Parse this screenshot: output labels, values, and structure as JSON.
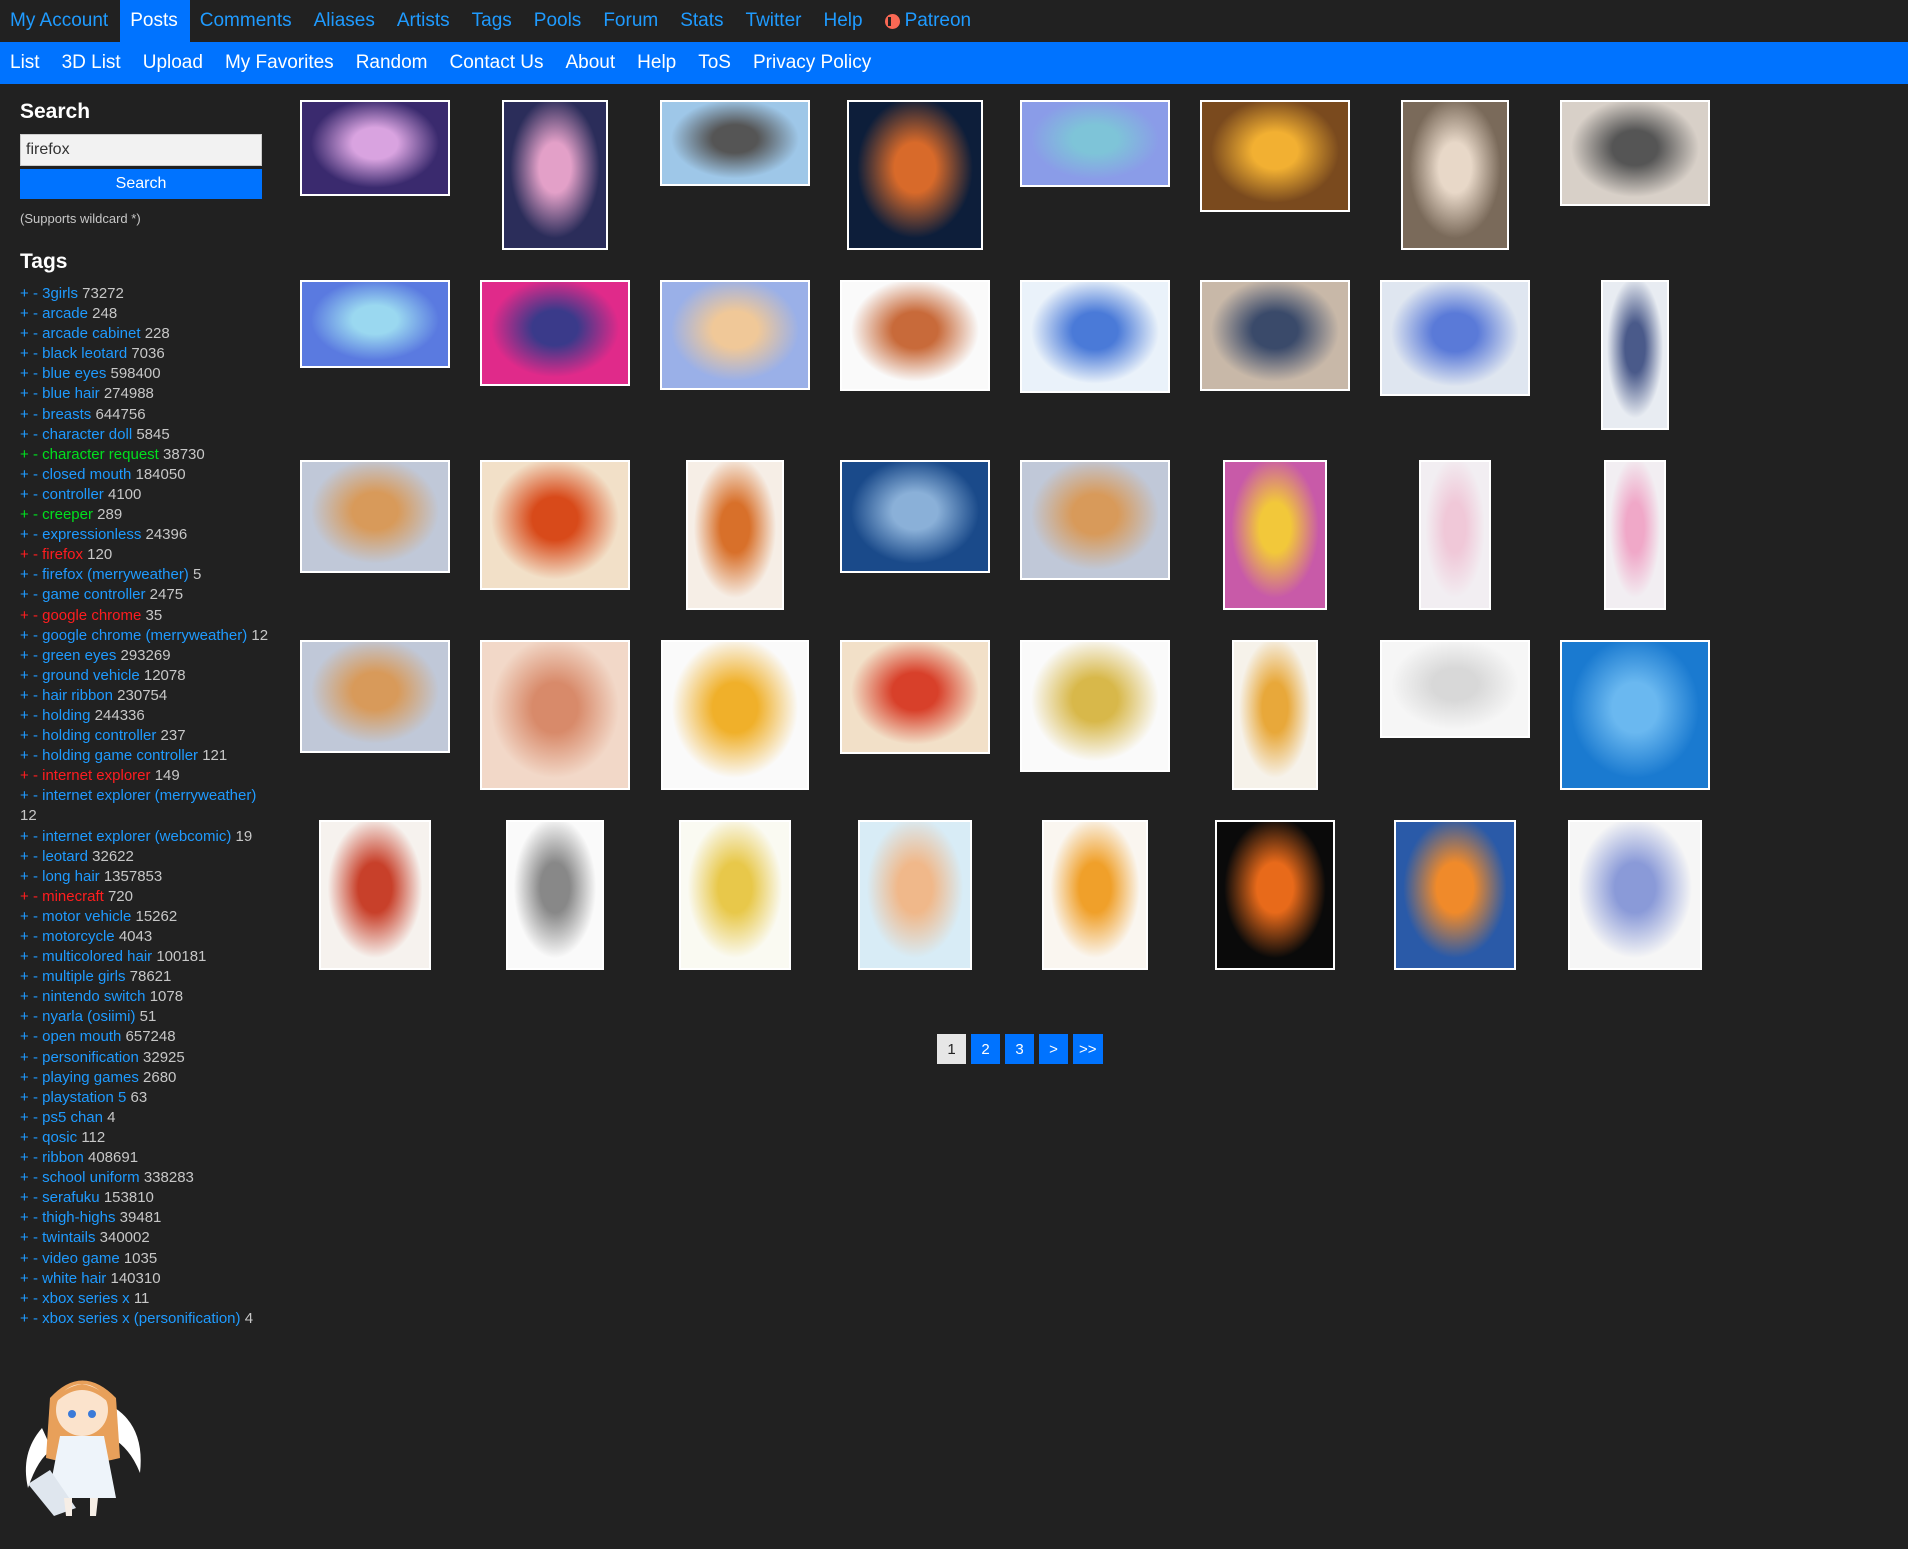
{
  "topnav": [
    {
      "label": "My Account",
      "active": false
    },
    {
      "label": "Posts",
      "active": true
    },
    {
      "label": "Comments",
      "active": false
    },
    {
      "label": "Aliases",
      "active": false
    },
    {
      "label": "Artists",
      "active": false
    },
    {
      "label": "Tags",
      "active": false
    },
    {
      "label": "Pools",
      "active": false
    },
    {
      "label": "Forum",
      "active": false
    },
    {
      "label": "Stats",
      "active": false
    },
    {
      "label": "Twitter",
      "active": false
    },
    {
      "label": "Help",
      "active": false
    },
    {
      "label": "Patreon",
      "active": false,
      "icon": "patreon-icon"
    }
  ],
  "subnav": [
    "List",
    "3D List",
    "Upload",
    "My Favorites",
    "Random",
    "Contact Us",
    "About",
    "Help",
    "ToS",
    "Privacy Policy"
  ],
  "search": {
    "heading": "Search",
    "value": "firefox",
    "button": "Search",
    "note": "(Supports wildcard *)"
  },
  "tags_heading": "Tags",
  "tags": [
    {
      "name": "3girls",
      "count": "73272",
      "type": "normal"
    },
    {
      "name": "arcade",
      "count": "248",
      "type": "normal"
    },
    {
      "name": "arcade cabinet",
      "count": "228",
      "type": "normal"
    },
    {
      "name": "black leotard",
      "count": "7036",
      "type": "normal"
    },
    {
      "name": "blue eyes",
      "count": "598400",
      "type": "normal"
    },
    {
      "name": "blue hair",
      "count": "274988",
      "type": "normal"
    },
    {
      "name": "breasts",
      "count": "644756",
      "type": "normal"
    },
    {
      "name": "character doll",
      "count": "5845",
      "type": "normal"
    },
    {
      "name": "character request",
      "count": "38730",
      "type": "green"
    },
    {
      "name": "closed mouth",
      "count": "184050",
      "type": "normal"
    },
    {
      "name": "controller",
      "count": "4100",
      "type": "normal"
    },
    {
      "name": "creeper",
      "count": "289",
      "type": "green"
    },
    {
      "name": "expressionless",
      "count": "24396",
      "type": "normal"
    },
    {
      "name": "firefox",
      "count": "120",
      "type": "red"
    },
    {
      "name": "firefox (merryweather)",
      "count": "5",
      "type": "normal"
    },
    {
      "name": "game controller",
      "count": "2475",
      "type": "normal"
    },
    {
      "name": "google chrome",
      "count": "35",
      "type": "red"
    },
    {
      "name": "google chrome (merryweather)",
      "count": "12",
      "type": "normal"
    },
    {
      "name": "green eyes",
      "count": "293269",
      "type": "normal"
    },
    {
      "name": "ground vehicle",
      "count": "12078",
      "type": "normal"
    },
    {
      "name": "hair ribbon",
      "count": "230754",
      "type": "normal"
    },
    {
      "name": "holding",
      "count": "244336",
      "type": "normal"
    },
    {
      "name": "holding controller",
      "count": "237",
      "type": "normal"
    },
    {
      "name": "holding game controller",
      "count": "121",
      "type": "normal"
    },
    {
      "name": "internet explorer",
      "count": "149",
      "type": "red"
    },
    {
      "name": "internet explorer (merryweather)",
      "count": "12",
      "type": "normal"
    },
    {
      "name": "internet explorer (webcomic)",
      "count": "19",
      "type": "normal"
    },
    {
      "name": "leotard",
      "count": "32622",
      "type": "normal"
    },
    {
      "name": "long hair",
      "count": "1357853",
      "type": "normal"
    },
    {
      "name": "minecraft",
      "count": "720",
      "type": "red"
    },
    {
      "name": "motor vehicle",
      "count": "15262",
      "type": "normal"
    },
    {
      "name": "motorcycle",
      "count": "4043",
      "type": "normal"
    },
    {
      "name": "multicolored hair",
      "count": "100181",
      "type": "normal"
    },
    {
      "name": "multiple girls",
      "count": "78621",
      "type": "normal"
    },
    {
      "name": "nintendo switch",
      "count": "1078",
      "type": "normal"
    },
    {
      "name": "nyarla (osiimi)",
      "count": "51",
      "type": "normal"
    },
    {
      "name": "open mouth",
      "count": "657248",
      "type": "normal"
    },
    {
      "name": "personification",
      "count": "32925",
      "type": "normal"
    },
    {
      "name": "playing games",
      "count": "2680",
      "type": "normal"
    },
    {
      "name": "playstation 5",
      "count": "63",
      "type": "normal"
    },
    {
      "name": "ps5 chan",
      "count": "4",
      "type": "normal"
    },
    {
      "name": "qosic",
      "count": "112",
      "type": "normal"
    },
    {
      "name": "ribbon",
      "count": "408691",
      "type": "normal"
    },
    {
      "name": "school uniform",
      "count": "338283",
      "type": "normal"
    },
    {
      "name": "serafuku",
      "count": "153810",
      "type": "normal"
    },
    {
      "name": "thigh-highs",
      "count": "39481",
      "type": "normal"
    },
    {
      "name": "twintails",
      "count": "340002",
      "type": "normal"
    },
    {
      "name": "video game",
      "count": "1035",
      "type": "normal"
    },
    {
      "name": "white hair",
      "count": "140310",
      "type": "normal"
    },
    {
      "name": "xbox series x",
      "count": "11",
      "type": "normal"
    },
    {
      "name": "xbox series x (personification)",
      "count": "4",
      "type": "normal"
    }
  ],
  "thumb_colors": [
    [
      "#3a2a6e",
      "#d9a3e0"
    ],
    [
      "#2b2d5a",
      "#e3a0c8"
    ],
    [
      "#9ec7e8",
      "#555555"
    ],
    [
      "#0d1e3a",
      "#d86a2a"
    ],
    [
      "#8a9ce8",
      "#7ec4d8"
    ],
    [
      "#7a4a1e",
      "#f2b032"
    ],
    [
      "#7a6a5a",
      "#e8d8c8"
    ],
    [
      "#d8d0c8",
      "#555555"
    ],
    [
      "#5a7ae0",
      "#9ad8f0"
    ],
    [
      "#e02a8a",
      "#3a3a8a"
    ],
    [
      "#9ab0e8",
      "#f0c898"
    ],
    [
      "#fafafa",
      "#c86a3a"
    ],
    [
      "#eaf2fa",
      "#4a7ad8"
    ],
    [
      "#c8b8a8",
      "#3a4a6a"
    ],
    [
      "#dfe6f0",
      "#5a7ad8"
    ],
    [
      "#e8ecf2",
      "#4a5a8a"
    ],
    [
      "#c0c8d8",
      "#d89a5a"
    ],
    [
      "#f2e0c8",
      "#d84a1a"
    ],
    [
      "#f6eee6",
      "#d8702a"
    ],
    [
      "#1a4a8a",
      "#8ab0d8"
    ],
    [
      "#c0c8d8",
      "#d89a5a"
    ],
    [
      "#c85aa8",
      "#f2c83a"
    ],
    [
      "#f2eef2",
      "#f0c8d8"
    ],
    [
      "#f2eef2",
      "#f0a8c8"
    ],
    [
      "#c0c8d8",
      "#d89a5a"
    ],
    [
      "#f2d8c8",
      "#d88a6a"
    ],
    [
      "#fafafa",
      "#f0b02a"
    ],
    [
      "#f2e0c8",
      "#d8402a"
    ],
    [
      "#fafafa",
      "#d8b84a"
    ],
    [
      "#f6f2ea",
      "#e8a83a"
    ],
    [
      "#f6f6f6",
      "#d8d8d8"
    ],
    [
      "#1a7ad0",
      "#6ab8f0"
    ],
    [
      "#f6f2ee",
      "#c8402a"
    ],
    [
      "#fafafa",
      "#888888"
    ],
    [
      "#fafaf2",
      "#e8c84a"
    ],
    [
      "#d8ecf6",
      "#f0b88a"
    ],
    [
      "#faf6f0",
      "#f0a02a"
    ],
    [
      "#0a0a0a",
      "#e86a1a"
    ],
    [
      "#2a5aa8",
      "#f08a2a"
    ],
    [
      "#f6f6f6",
      "#8a9ad8"
    ]
  ],
  "pagination": [
    "1",
    "2",
    "3",
    ">",
    ">>"
  ]
}
